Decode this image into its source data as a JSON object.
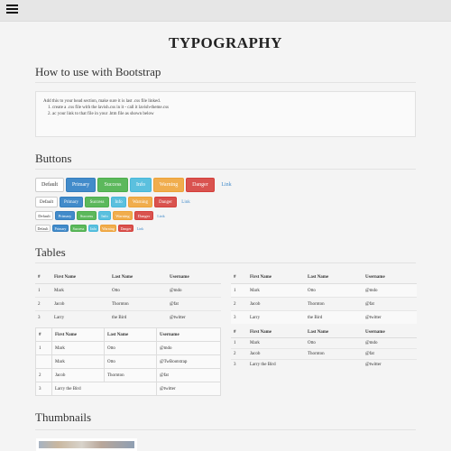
{
  "page": {
    "title": "TYPOGRAPHY"
  },
  "bootstrap": {
    "heading": "How to use with Bootstrap",
    "intro": "Add this to your head section, make sure it is last .css file linked.",
    "steps": [
      "create a .css file with the lavish.css in it - call it lavish-theme.css",
      "ac your link to that file in your .htm file as shown below"
    ]
  },
  "buttons": {
    "heading": "Buttons",
    "labels": [
      "Default",
      "Primary",
      "Success",
      "Info",
      "Warning",
      "Danger",
      "Link"
    ]
  },
  "tables": {
    "heading": "Tables",
    "headers": [
      "#",
      "First Name",
      "Last Name",
      "Username"
    ],
    "rows": [
      [
        "1",
        "Mark",
        "Otto",
        "@mdo"
      ],
      [
        "2",
        "Jacob",
        "Thornton",
        "@fat"
      ],
      [
        "3",
        "Larry",
        "the Bird",
        "@twitter"
      ]
    ],
    "bordered_rows": [
      [
        "1",
        "Mark",
        "Otto",
        "@mdo"
      ],
      [
        "",
        "Mark",
        "Otto",
        "@TwBootstrap"
      ],
      [
        "2",
        "Jacob",
        "Thornton",
        "@fat"
      ],
      [
        "3",
        "Larry the Bird",
        "",
        "@twitter"
      ]
    ],
    "condensed_rows": [
      [
        "1",
        "Mark",
        "Otto",
        "@mdo"
      ],
      [
        "2",
        "Jacob",
        "Thornton",
        "@fat"
      ],
      [
        "3",
        "Larry the Bird",
        "",
        "@twitter"
      ]
    ]
  },
  "thumbnails": {
    "heading": "Thumbnails"
  },
  "colors": {
    "primary": "#428bca",
    "success": "#5cb85c",
    "info": "#5bc0de",
    "warning": "#f0ad4e",
    "danger": "#d9534f"
  }
}
